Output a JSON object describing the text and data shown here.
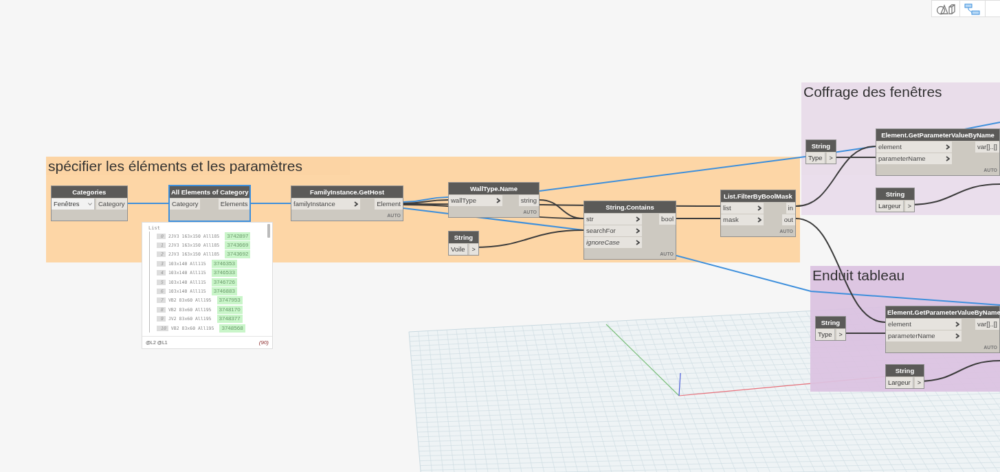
{
  "groups": [
    {
      "title": "spécifier les éléments et les paramètres",
      "color": "#fdd29e"
    },
    {
      "title": "Coffrage des fenêtres",
      "color": "#e8dbea"
    },
    {
      "title": "Enduit tableau",
      "color": "#dbc2e1"
    }
  ],
  "nodes": [
    {
      "title": "Categories",
      "selected": false,
      "inputs": [
        {
          "kind": "dropdown",
          "value": "Fenêtres"
        }
      ],
      "outputs": [
        "Category"
      ]
    },
    {
      "title": "All Elements of Category",
      "selected": true,
      "inputs": [
        {
          "kind": "label",
          "label": "Category"
        }
      ],
      "outputs": [
        "Elements"
      ]
    },
    {
      "title": "FamilyInstance.GetHost",
      "selected": false,
      "inputs": [
        {
          "kind": "port",
          "label": "familyInstance",
          "uses_default": false
        }
      ],
      "outputs": [
        "Element"
      ],
      "lacing": "AUTO"
    },
    {
      "title": "WallType.Name",
      "selected": false,
      "inputs": [
        {
          "kind": "port",
          "label": "wallType",
          "uses_default": false
        }
      ],
      "outputs": [
        "string"
      ],
      "lacing": "AUTO"
    },
    {
      "title": "String",
      "selected": false,
      "inputs": [
        {
          "kind": "text",
          "value": "Voile"
        }
      ],
      "outputs": [
        ">"
      ]
    },
    {
      "title": "String.Contains",
      "selected": false,
      "inputs": [
        {
          "kind": "port",
          "label": "str",
          "uses_default": false
        },
        {
          "kind": "port",
          "label": "searchFor",
          "uses_default": false
        },
        {
          "kind": "port",
          "label": "ignoreCase",
          "uses_default": true
        }
      ],
      "outputs": [
        "bool"
      ],
      "lacing": "AUTO"
    },
    {
      "title": "List.FilterByBoolMask",
      "selected": false,
      "inputs": [
        {
          "kind": "port",
          "label": "list",
          "uses_default": false
        },
        {
          "kind": "port",
          "label": "mask",
          "uses_default": false
        }
      ],
      "outputs": [
        "in",
        "out"
      ],
      "lacing": "AUTO"
    },
    {
      "title": "String",
      "selected": false,
      "inputs": [
        {
          "kind": "text",
          "value": "Type"
        }
      ],
      "outputs": [
        ">"
      ]
    },
    {
      "title": "Element.GetParameterValueByName",
      "selected": false,
      "inputs": [
        {
          "kind": "port",
          "label": "element",
          "uses_default": false
        },
        {
          "kind": "port",
          "label": "parameterName",
          "uses_default": false
        }
      ],
      "outputs": [
        "var[]..[]"
      ],
      "lacing": "AUTO"
    },
    {
      "title": "String",
      "selected": false,
      "inputs": [
        {
          "kind": "text",
          "value": "Largeur"
        }
      ],
      "outputs": [
        ">"
      ]
    },
    {
      "title": "String",
      "selected": false,
      "inputs": [
        {
          "kind": "text",
          "value": "Type"
        }
      ],
      "outputs": [
        ">"
      ]
    },
    {
      "title": "Element.GetParameterValueByName",
      "selected": false,
      "inputs": [
        {
          "kind": "port",
          "label": "element",
          "uses_default": false
        },
        {
          "kind": "port",
          "label": "parameterName",
          "uses_default": false
        }
      ],
      "outputs": [
        "var[]..[]"
      ],
      "lacing": "AUTO"
    },
    {
      "title": "String",
      "selected": false,
      "inputs": [
        {
          "kind": "text",
          "value": "Largeur"
        }
      ],
      "outputs": [
        ">"
      ]
    }
  ],
  "preview": {
    "label": "List",
    "items": [
      {
        "index": "0",
        "text": "2JV3 163x150 All185",
        "id": "3742897"
      },
      {
        "index": "1",
        "text": "2JV3 163x150 All185",
        "id": "3743669"
      },
      {
        "index": "2",
        "text": "2JV3 163x150 All185",
        "id": "3743692"
      },
      {
        "index": "3",
        "text": "103x140 All115",
        "id": "3746353"
      },
      {
        "index": "4",
        "text": "103x140 All115",
        "id": "3746533"
      },
      {
        "index": "5",
        "text": "103x140 All115",
        "id": "3746726"
      },
      {
        "index": "6",
        "text": "103x140 All115",
        "id": "3746883"
      },
      {
        "index": "7",
        "text": "VB2 83x60 All195",
        "id": "3747953"
      },
      {
        "index": "8",
        "text": "VB2 83x60 All195",
        "id": "3748170"
      },
      {
        "index": "9",
        "text": "JV2 83x60 All195",
        "id": "3748377"
      },
      {
        "index": "10",
        "text": "VB2 83x60 All195",
        "id": "3748568"
      }
    ],
    "levels": "@L2 @L1",
    "count": "(90)"
  }
}
